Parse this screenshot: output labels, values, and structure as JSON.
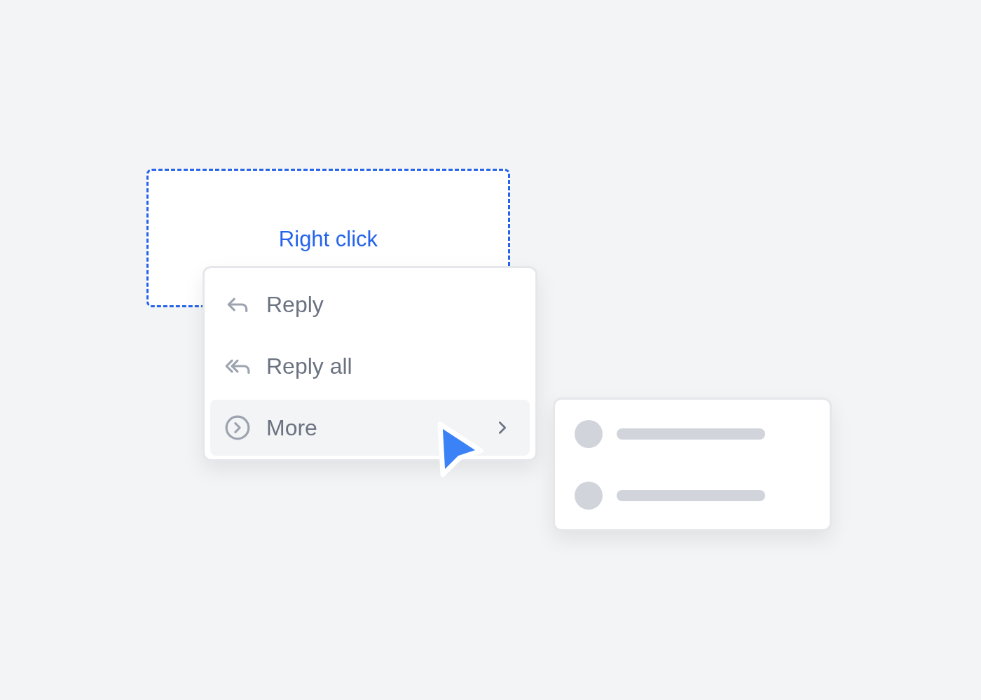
{
  "target": {
    "label": "Right click"
  },
  "menu": {
    "items": [
      {
        "label": "Reply",
        "kind": "reply",
        "selected": false
      },
      {
        "label": "Reply all",
        "kind": "reply_all",
        "selected": false
      },
      {
        "label": "More",
        "kind": "submenu",
        "selected": true
      }
    ]
  }
}
